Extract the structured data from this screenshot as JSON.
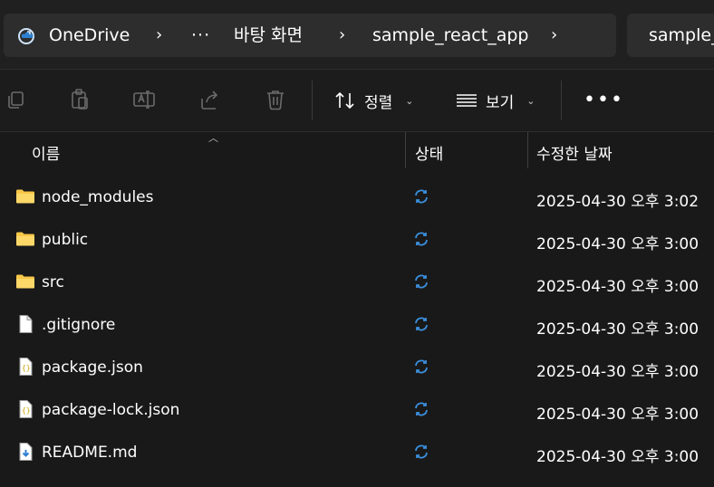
{
  "breadcrumb": {
    "items": [
      {
        "label": "OneDrive",
        "icon": "onedrive-icon"
      },
      {
        "label": "···"
      },
      {
        "label": "바탕 화면"
      },
      {
        "label": "sample_react_app"
      }
    ],
    "separator": "›",
    "search_partial": "sample_"
  },
  "toolbar": {
    "buttons": [
      {
        "name": "copy",
        "icon": "copy-icon"
      },
      {
        "name": "paste",
        "icon": "paste-icon"
      },
      {
        "name": "rename",
        "icon": "rename-icon"
      },
      {
        "name": "share",
        "icon": "share-icon"
      },
      {
        "name": "delete",
        "icon": "delete-icon"
      }
    ],
    "sort_label": "정렬",
    "view_label": "보기",
    "more_label": "•••"
  },
  "columns": {
    "name": "이름",
    "status": "상태",
    "modified": "수정한 날짜"
  },
  "files": [
    {
      "name": "node_modules",
      "type": "folder",
      "status": "sync",
      "modified": "2025-04-30 오후 3:02"
    },
    {
      "name": "public",
      "type": "folder",
      "status": "sync",
      "modified": "2025-04-30 오후 3:00"
    },
    {
      "name": "src",
      "type": "folder",
      "status": "sync",
      "modified": "2025-04-30 오후 3:00"
    },
    {
      "name": ".gitignore",
      "type": "file",
      "status": "sync",
      "modified": "2025-04-30 오후 3:00"
    },
    {
      "name": "package.json",
      "type": "json",
      "status": "sync",
      "modified": "2025-04-30 오후 3:00"
    },
    {
      "name": "package-lock.json",
      "type": "json",
      "status": "sync",
      "modified": "2025-04-30 오후 3:00"
    },
    {
      "name": "README.md",
      "type": "markdown",
      "status": "sync",
      "modified": "2025-04-30 오후 3:00"
    }
  ],
  "colors": {
    "folder": "#f7c748",
    "sync": "#3b8edb",
    "background": "#191919"
  }
}
